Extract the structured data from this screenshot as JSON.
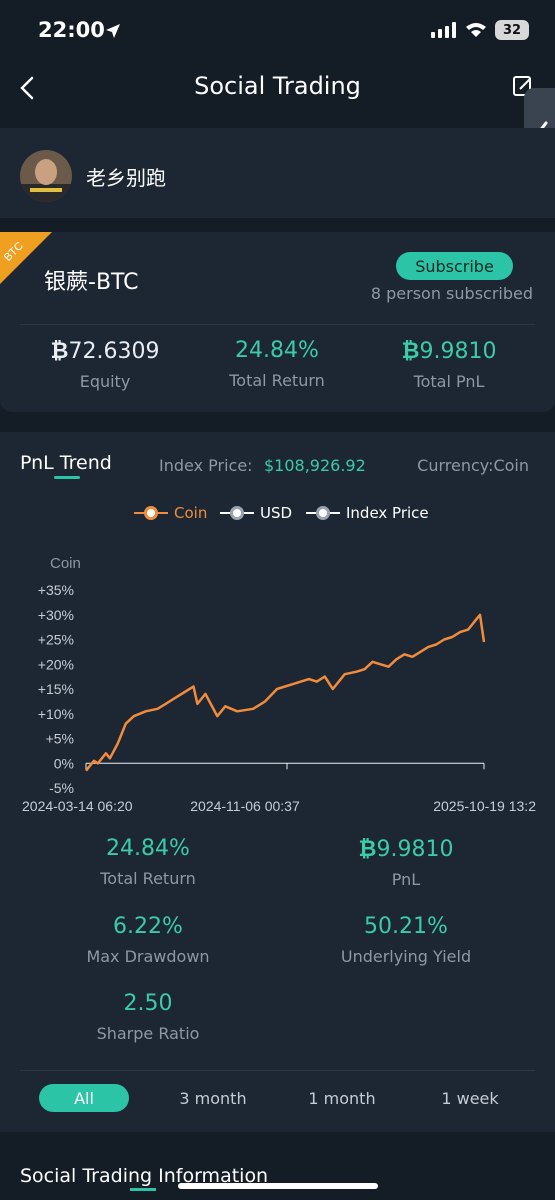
{
  "status_bar": {
    "time": "22:00",
    "battery": "32"
  },
  "nav": {
    "title": "Social Trading"
  },
  "user": {
    "name": "老乡别跑"
  },
  "strategy": {
    "badge": "BTC",
    "name": "银蕨-BTC",
    "subscribe_label": "Subscribe",
    "subscribed_text": "8 person subscribed",
    "equity": {
      "value": "72.6309",
      "label": "Equity"
    },
    "total_return": {
      "value": "24.84%",
      "label": "Total Return"
    },
    "total_pnl": {
      "value": "9.9810",
      "label": "Total PnL"
    }
  },
  "trend": {
    "tab_label": "PnL Trend",
    "index_price_label": "Index Price:",
    "index_price_value": "$108,926.92",
    "currency_label": "Currency:",
    "currency_value": "Coin",
    "legend": [
      {
        "label": "Coin",
        "color": "#f08c3c"
      },
      {
        "label": "USD",
        "color": "#ffffff"
      },
      {
        "label": "Index Price",
        "color": "#ffffff"
      }
    ]
  },
  "chart_data": {
    "type": "line",
    "y_unit": "Coin",
    "y_ticks": [
      "+35%",
      "+30%",
      "+25%",
      "+20%",
      "+15%",
      "+10%",
      "+5%",
      "0%",
      "-5%"
    ],
    "x_ticks": [
      "2024-03-14 06:20",
      "2024-11-06 00:37",
      "2025-10-19 13:2"
    ],
    "ylim": [
      -5,
      35
    ],
    "series": [
      {
        "name": "Coin",
        "color": "#f08c3c",
        "x": [
          0,
          0.01,
          0.02,
          0.03,
          0.05,
          0.06,
          0.08,
          0.1,
          0.12,
          0.15,
          0.18,
          0.2,
          0.23,
          0.25,
          0.27,
          0.28,
          0.3,
          0.33,
          0.35,
          0.38,
          0.42,
          0.45,
          0.48,
          0.5,
          0.52,
          0.54,
          0.56,
          0.58,
          0.6,
          0.62,
          0.65,
          0.68,
          0.7,
          0.72,
          0.74,
          0.76,
          0.78,
          0.8,
          0.82,
          0.84,
          0.86,
          0.88,
          0.9,
          0.92,
          0.94,
          0.96,
          0.97,
          0.98,
          0.99,
          1.0
        ],
        "values": [
          -1.5,
          -0.5,
          0.5,
          0.0,
          2.0,
          1.0,
          4.0,
          8.0,
          9.5,
          10.5,
          11.0,
          12.0,
          13.5,
          14.5,
          15.5,
          12.0,
          14.0,
          9.5,
          11.5,
          10.5,
          11.0,
          12.5,
          15.0,
          15.5,
          16.0,
          16.5,
          17.0,
          16.5,
          17.5,
          15.0,
          18.0,
          18.5,
          19.0,
          20.5,
          20.0,
          19.5,
          21.0,
          22.0,
          21.5,
          22.5,
          23.5,
          24.0,
          25.0,
          25.5,
          26.5,
          27.0,
          28.0,
          29.0,
          30.0,
          24.5
        ]
      }
    ]
  },
  "metrics": {
    "total_return": {
      "value": "24.84%",
      "label": "Total Return"
    },
    "pnl": {
      "value": "9.9810",
      "label": "PnL"
    },
    "max_drawdown": {
      "value": "6.22%",
      "label": "Max Drawdown"
    },
    "underlying_yield": {
      "value": "50.21%",
      "label": "Underlying Yield"
    },
    "sharpe": {
      "value": "2.50",
      "label": "Sharpe Ratio"
    }
  },
  "ranges": [
    "All",
    "3 month",
    "1 month",
    "1 week"
  ],
  "info": {
    "title": "Social Trading Information"
  },
  "colors": {
    "accent": "#2cc4a6",
    "coin_line": "#f08c3c",
    "bg": "#141c26",
    "card": "#1d2733"
  }
}
